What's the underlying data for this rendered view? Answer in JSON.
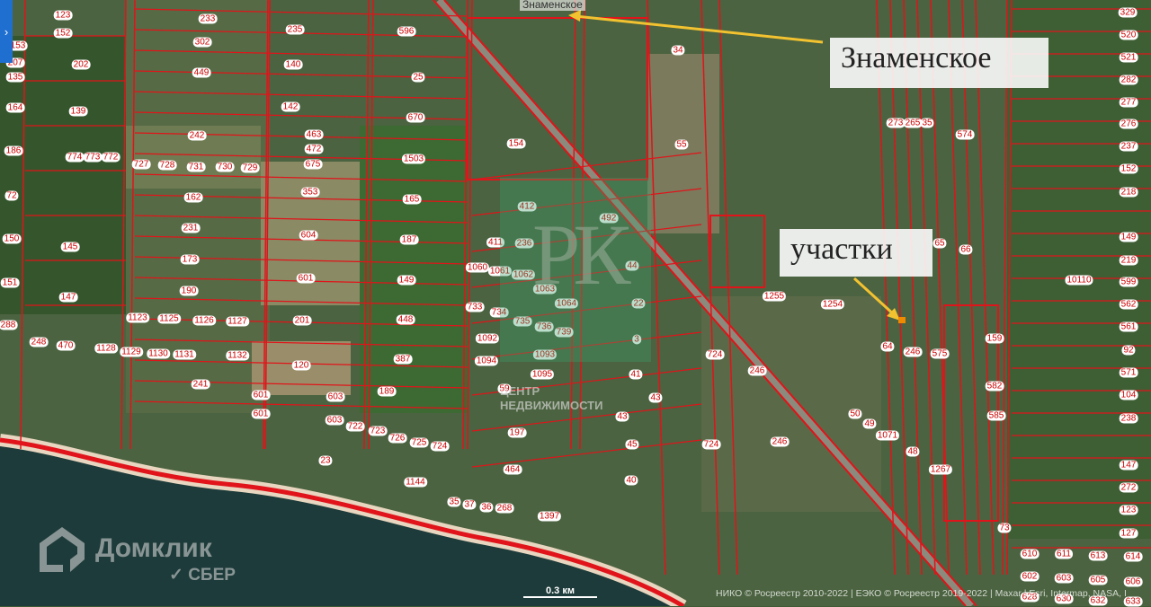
{
  "map": {
    "town_label": "Знаменское",
    "callouts": {
      "village": "Знаменское",
      "plots": "участки"
    },
    "parcels": [
      "123",
      "152",
      "202",
      "139",
      "233",
      "302",
      "449",
      "242",
      "235",
      "140",
      "142",
      "463",
      "472",
      "675",
      "353",
      "596",
      "25",
      "670",
      "1503",
      "165",
      "187",
      "149",
      "448",
      "387",
      "189",
      "604",
      "601",
      "201",
      "120",
      "162",
      "231",
      "173",
      "190",
      "145",
      "147",
      "248",
      "470",
      "241",
      "154",
      "412",
      "492",
      "411",
      "236",
      "44",
      "22",
      "3",
      "1064",
      "41",
      "43",
      "43",
      "45",
      "40",
      "197",
      "464",
      "59",
      "1095",
      "1093",
      "1092",
      "1094",
      "1144",
      "23",
      "724",
      "724",
      "246",
      "246",
      "1255",
      "1254",
      "55",
      "34",
      "574",
      "66",
      "65",
      "273",
      "265",
      "35",
      "246",
      "575",
      "159",
      "582",
      "585",
      "1267",
      "48",
      "1071",
      "50",
      "49",
      "64",
      "73",
      "329",
      "520",
      "521",
      "282",
      "277",
      "276",
      "237",
      "152",
      "218",
      "149",
      "219",
      "10110",
      "599",
      "562",
      "561",
      "92",
      "571",
      "104",
      "238",
      "147",
      "272",
      "123",
      "127",
      "610",
      "611",
      "613",
      "614",
      "602",
      "603",
      "605",
      "606",
      "628",
      "630",
      "632",
      "633",
      "1123",
      "1125",
      "1126",
      "1127",
      "601",
      "601",
      "603",
      "603",
      "35",
      "37",
      "36",
      "268",
      "1397",
      "288",
      "151",
      "150",
      "72",
      "186",
      "164",
      "135",
      "207",
      "153",
      "727",
      "728",
      "731",
      "730",
      "729",
      "774",
      "773",
      "772",
      "1128",
      "1129",
      "1130",
      "1131",
      "1132",
      "722",
      "723",
      "726",
      "725",
      "724",
      "1060",
      "1061",
      "1062",
      "1063",
      "733",
      "734",
      "735",
      "736",
      "739"
    ],
    "colors": {
      "parcel": "#e0141a",
      "arrow": "#f2c230",
      "plot_marker": "#f08a00"
    }
  },
  "watermark": {
    "letters": "РК",
    "text_line1": "ЦЕНТР",
    "text_line2": "НЕДВИЖИМОСТИ"
  },
  "logo": {
    "name": "Домклик",
    "sub": "СБЕР"
  },
  "scale": "0.3 км",
  "attribution": "НИКО © Росреестр 2010-2022 | ЕЭКО © Росреестр 2019-2022 | Maxar | Esri, Intermap, NASA, I",
  "panel_toggle": "›"
}
